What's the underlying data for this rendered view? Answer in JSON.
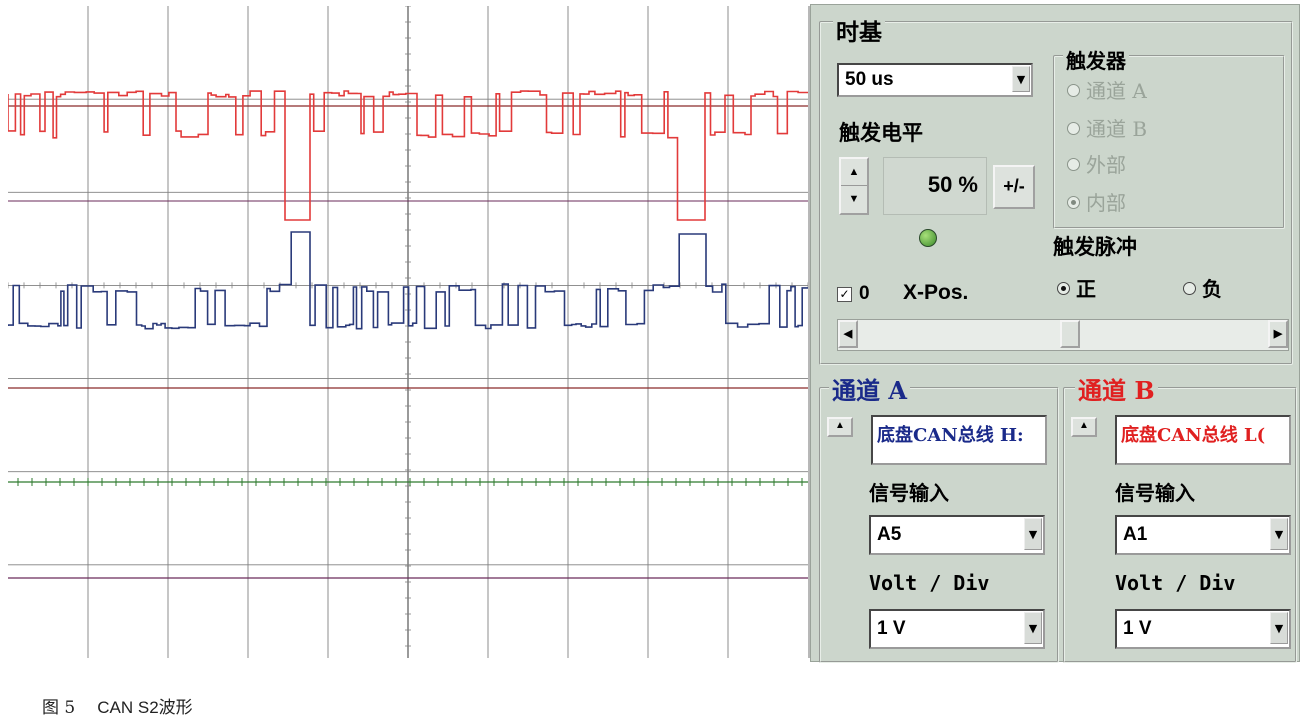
{
  "scope": {
    "colors": {
      "grid": "#808080",
      "channel_a": "#e23a3a",
      "channel_b": "#2a3a7a",
      "ref_red": "#8b2a2a",
      "ref_green": "#2e7a2e",
      "ref_purple": "#6a2a5a"
    }
  },
  "timebase": {
    "title": "时基",
    "value": "50 us",
    "trigger_level_label": "触发电平",
    "trigger_level_value": "50 %",
    "invert_button": "+/-",
    "xpos_checkbox_label": "0",
    "xpos_label": "X-Pos."
  },
  "trigger": {
    "title": "触发器",
    "options": [
      "通道 A",
      "通道 B",
      "外部",
      "内部"
    ],
    "selected": "内部",
    "pulse_title": "触发脉冲",
    "pulse_options": [
      "正",
      "负"
    ],
    "pulse_selected": "正"
  },
  "channel_a": {
    "title": "通道 A",
    "name": "底盘CAN总线 H:",
    "signal_input_label": "信号输入",
    "signal_input_value": "A5",
    "volt_div_label": "Volt / Div",
    "volt_div_value": "1 V",
    "title_color": "#1a2a8a"
  },
  "channel_b": {
    "title": "通道 B",
    "name": "底盘CAN总线 L(",
    "signal_input_label": "信号输入",
    "signal_input_value": "A1",
    "volt_div_label": "Volt / Div",
    "volt_div_value": "1 V",
    "title_color": "#e02020"
  },
  "caption": {
    "figure": "图 5",
    "text": "CAN S2波形"
  }
}
